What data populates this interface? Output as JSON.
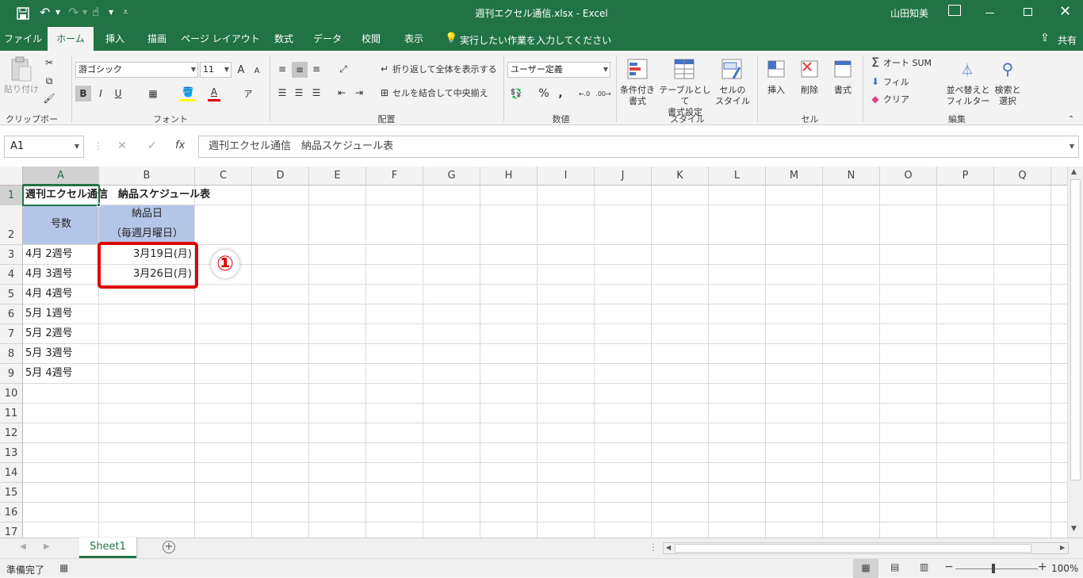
{
  "titlebar": {
    "doc_title": "週刊エクセル通信.xlsx  -  Excel",
    "user": "山田知美",
    "save_icon": "save-icon",
    "undo_icon": "undo-icon",
    "redo_icon": "redo-icon",
    "touch_icon": "touch-mode-icon",
    "customize_icon": "customize-qat-icon"
  },
  "tabs": [
    "ファイル",
    "ホーム",
    "挿入",
    "描画",
    "ページ レイアウト",
    "数式",
    "データ",
    "校閲",
    "表示"
  ],
  "tell_me": "実行したい作業を入力してください",
  "share": "共有",
  "ribbon": {
    "clipboard": {
      "paste": "貼り付け",
      "label": "クリップボード"
    },
    "font": {
      "name": "游ゴシック",
      "size": "11",
      "label": "フォント",
      "bold": "B",
      "italic": "I",
      "underline": "U",
      "grow": "A",
      "shrink": "A",
      "color_a": "A"
    },
    "align": {
      "wrap": "折り返して全体を表示する",
      "merge": "セルを結合して中央揃え",
      "label": "配置"
    },
    "number": {
      "format": "ユーザー定義",
      "label": "数値",
      "percent": "%",
      "comma": ",",
      "inc": "←.0",
      "dec": ".00→"
    },
    "styles": {
      "cond1": "条件付き",
      "cond2": "書式",
      "table1": "テーブルとして",
      "table2": "書式設定",
      "cell1": "セルの",
      "cell2": "スタイル",
      "label": "スタイル"
    },
    "cells": {
      "insert": "挿入",
      "delete": "削除",
      "format": "書式",
      "label": "セル"
    },
    "edit": {
      "autosum": "オート SUM",
      "fill": "フィル",
      "clear": "クリア",
      "sort1": "並べ替えと",
      "sort2": "フィルター",
      "find1": "検索と",
      "find2": "選択",
      "label": "編集"
    }
  },
  "formula_bar": {
    "name_box": "A1",
    "fx": "fx",
    "content": "週刊エクセル通信　納品スケジュール表"
  },
  "columns": [
    "A",
    "B",
    "C",
    "D",
    "E",
    "F",
    "G",
    "H",
    "I",
    "J",
    "K",
    "L",
    "M",
    "N",
    "O",
    "P",
    "Q"
  ],
  "rows": [
    "1",
    "2",
    "3",
    "4",
    "5",
    "6",
    "7",
    "8",
    "9",
    "10",
    "11",
    "12",
    "13",
    "14",
    "15",
    "16",
    "17"
  ],
  "cells": {
    "A1": "週刊エクセル通信　納品スケジュール表",
    "A2": "号数",
    "B2a": "納品日",
    "B2b": "（毎週月曜日）",
    "A3": "4月 2週号",
    "B3": "3月19日(月)",
    "A4": "4月 3週号",
    "B4": "3月26日(月)",
    "A5": "4月 4週号",
    "A6": "5月 1週号",
    "A7": "5月 2週号",
    "A8": "5月 3週号",
    "A9": "5月 4週号"
  },
  "annotation": "①",
  "sheet_tab": "Sheet1",
  "status": {
    "ready": "準備完了",
    "zoom": "100%"
  },
  "colors": {
    "excel_green": "#217346",
    "header_fill": "#b4c6e7",
    "highlight_red": "#e00000"
  }
}
